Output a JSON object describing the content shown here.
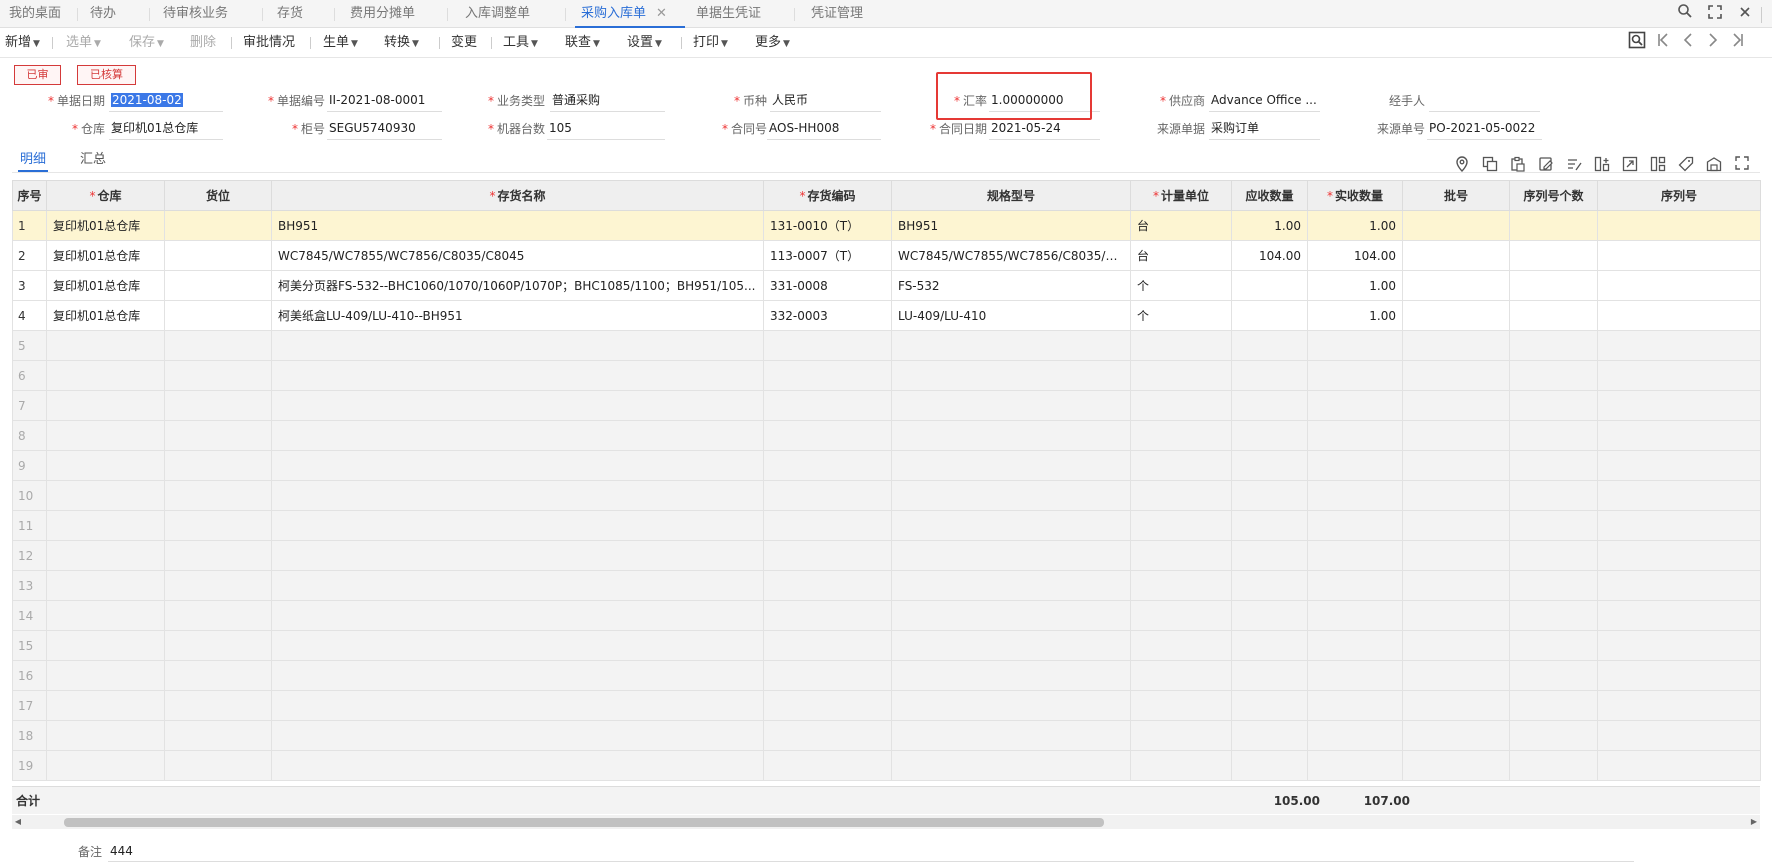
{
  "tabs": [
    {
      "label": "我的桌面"
    },
    {
      "label": "待办"
    },
    {
      "label": "待审核业务"
    },
    {
      "label": "存货"
    },
    {
      "label": "费用分摊单"
    },
    {
      "label": "入库调整单"
    },
    {
      "label": "采购入库单"
    },
    {
      "label": "单据生凭证"
    },
    {
      "label": "凭证管理"
    }
  ],
  "toolbar": {
    "new": "新增",
    "select": "选单",
    "save": "保存",
    "delete": "删除",
    "approval": "审批情况",
    "generate": "生单",
    "convert": "转换",
    "change": "变更",
    "tools": "工具",
    "query": "联查",
    "settings": "设置",
    "print": "打印",
    "more": "更多"
  },
  "status": {
    "audited": "已审",
    "accounted": "已核算"
  },
  "form": {
    "doc_date": {
      "label": "单据日期",
      "value": "2021-08-02"
    },
    "doc_no": {
      "label": "单据编号",
      "value": "II-2021-08-0001"
    },
    "biz_type": {
      "label": "业务类型",
      "value": "普通采购"
    },
    "currency": {
      "label": "币种",
      "value": "人民币"
    },
    "exchange_rate": {
      "label": "汇率",
      "value": "1.00000000"
    },
    "supplier": {
      "label": "供应商",
      "value": "Advance Office ..."
    },
    "handler": {
      "label": "经手人",
      "value": ""
    },
    "warehouse": {
      "label": "仓库",
      "value": "复印机01总仓库"
    },
    "cabinet_no": {
      "label": "柜号",
      "value": "SEGU5740930"
    },
    "machine_count": {
      "label": "机器台数",
      "value": "105"
    },
    "contract_no": {
      "label": "合同号",
      "value": "AOS-HH008"
    },
    "contract_date": {
      "label": "合同日期",
      "value": "2021-05-24"
    },
    "source_doc": {
      "label": "来源单据",
      "value": "采购订单"
    },
    "source_no": {
      "label": "来源单号",
      "value": "PO-2021-05-0022"
    }
  },
  "subtabs": {
    "detail": "明细",
    "summary": "汇总"
  },
  "table": {
    "headers": {
      "row_no": "序号",
      "warehouse": "仓库",
      "location": "货位",
      "item_name": "存货名称",
      "item_code": "存货编码",
      "spec": "规格型号",
      "unit": "计量单位",
      "qty_due": "应收数量",
      "qty_received": "实收数量",
      "batch": "批号",
      "serial_count": "序列号个数",
      "serial_no": "序列号"
    },
    "rows": [
      {
        "row_no": "1",
        "warehouse": "复印机01总仓库",
        "location": "",
        "item_name": "BH951",
        "item_code": "131-0010（T）",
        "spec": "BH951",
        "unit": "台",
        "qty_due": "1.00",
        "qty_received": "1.00",
        "batch": "",
        "serial_count": "",
        "serial_no": ""
      },
      {
        "row_no": "2",
        "warehouse": "复印机01总仓库",
        "location": "",
        "item_name": "WC7845/WC7855/WC7856/C8035/C8045",
        "item_code": "113-0007（T）",
        "spec": "WC7845/WC7855/WC7856/C8035/C...",
        "unit": "台",
        "qty_due": "104.00",
        "qty_received": "104.00",
        "batch": "",
        "serial_count": "",
        "serial_no": ""
      },
      {
        "row_no": "3",
        "warehouse": "复印机01总仓库",
        "location": "",
        "item_name": "柯美分页器FS-532--BHC1060/1070/1060P/1070P；BHC1085/1100；BH951/105...",
        "item_code": "331-0008",
        "spec": "FS-532",
        "unit": "个",
        "qty_due": "",
        "qty_received": "1.00",
        "batch": "",
        "serial_count": "",
        "serial_no": ""
      },
      {
        "row_no": "4",
        "warehouse": "复印机01总仓库",
        "location": "",
        "item_name": "柯美纸盒LU-409/LU-410--BH951",
        "item_code": "332-0003",
        "spec": "LU-409/LU-410",
        "unit": "个",
        "qty_due": "",
        "qty_received": "1.00",
        "batch": "",
        "serial_count": "",
        "serial_no": ""
      }
    ],
    "empty_rows": [
      "5",
      "6",
      "7",
      "8",
      "9",
      "10",
      "11",
      "12",
      "13",
      "14",
      "15",
      "16",
      "17",
      "18",
      "19"
    ],
    "total": {
      "label": "合计",
      "qty_due": "105.00",
      "qty_received": "107.00"
    }
  },
  "remark": {
    "label": "备注",
    "value": "444"
  },
  "colors": {
    "accent": "#2a6ed6",
    "highlight_border": "#e53935",
    "selected_row": "#fdf5d2",
    "stamp": "#d43a3a"
  }
}
